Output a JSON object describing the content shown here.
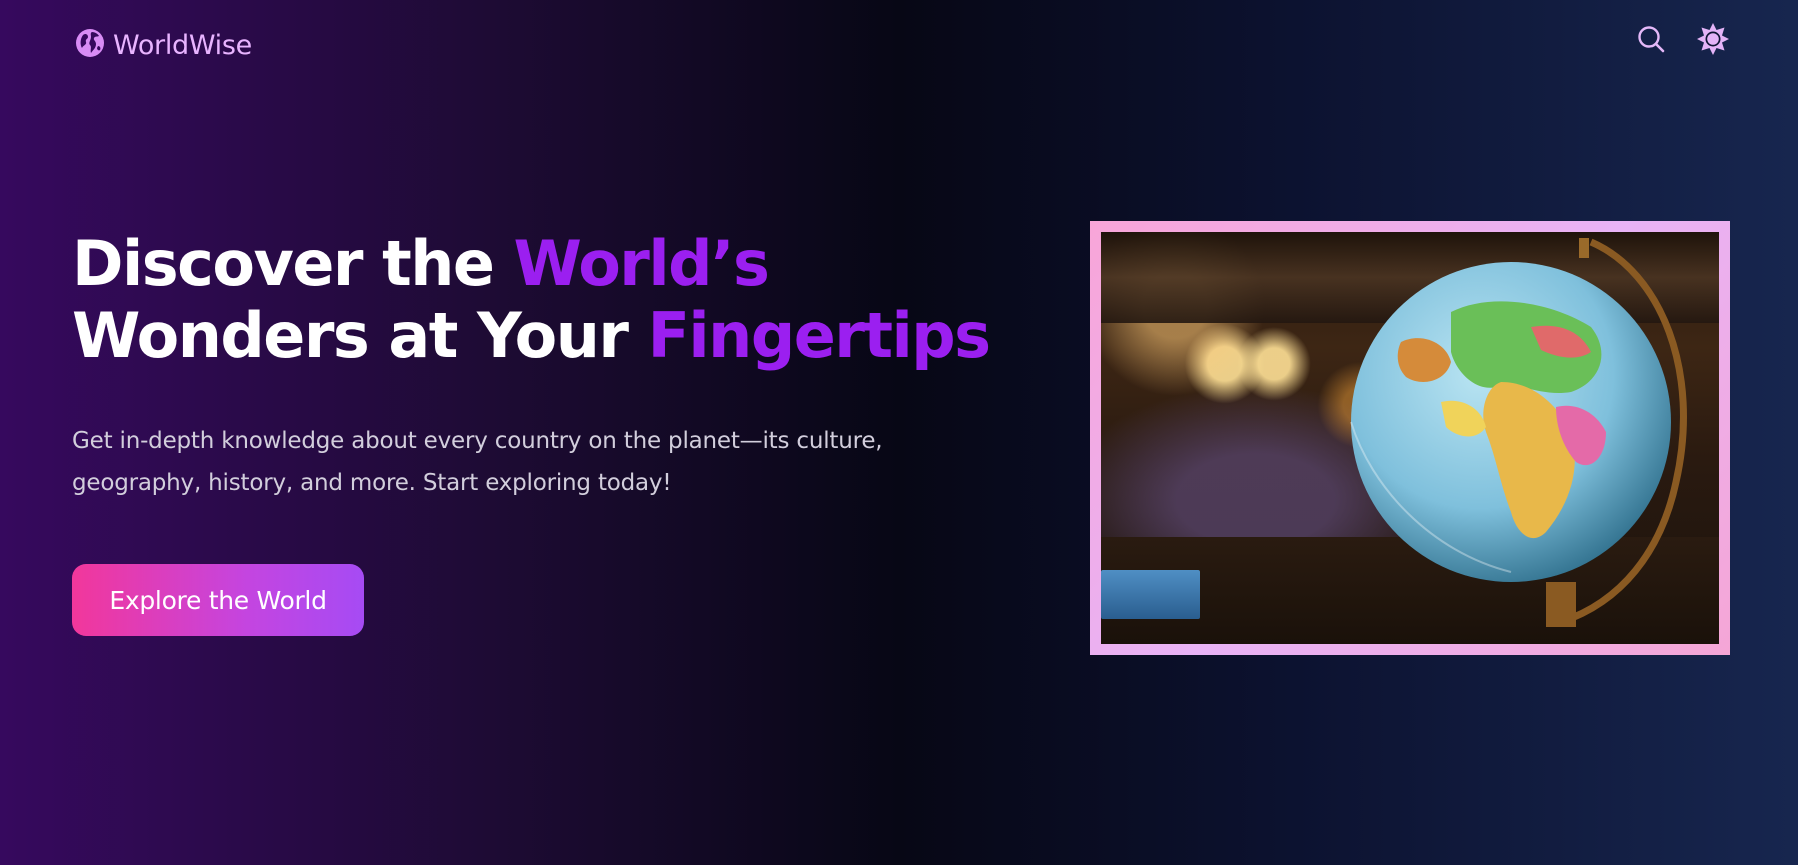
{
  "app": {
    "brand": "WorldWise",
    "brand_icon": "globe-icon"
  },
  "nav": {
    "search_icon": "search-icon",
    "theme_icon": "sun-icon"
  },
  "hero": {
    "headline_line1_plain": "Discover the ",
    "headline_line1_accent": "World’s",
    "headline_line2_plain": "Wonders at Your ",
    "headline_line2_accent": "Fingertips",
    "subtitle": "Get in-depth knowledge about every country on the planet—its culture, geography, history, and more. Start exploring today!",
    "cta_label": "Explore the World"
  },
  "colors": {
    "accent": "#9b1ff0",
    "brand": "#e8b4ff",
    "cta_start": "#f2379b",
    "cta_end": "#a64bf4",
    "frame": "#f8a5d8"
  }
}
